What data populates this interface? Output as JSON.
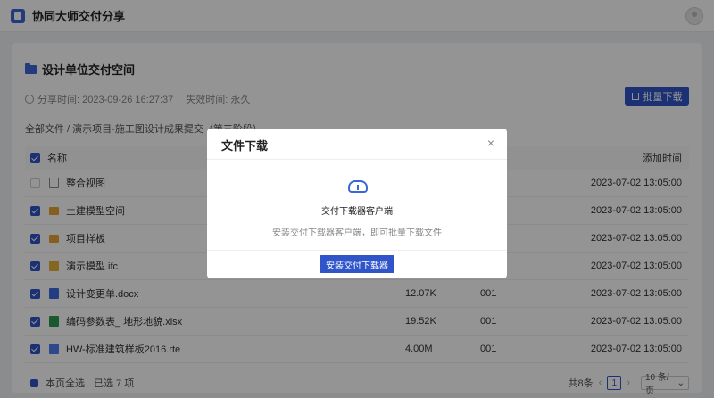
{
  "app": {
    "title": "协同大师交付分享"
  },
  "space": {
    "title": "设计单位交付空间",
    "share_time": "分享时间: 2023-09-26 16:27:37",
    "expire_time": "失效时间: 永久",
    "batch_download": "批量下载",
    "breadcrumb": "全部文件 / 演示项目-施工图设计成果提交（第三阶段）"
  },
  "table": {
    "headers": {
      "name": "名称",
      "time": "添加时间"
    },
    "rows": [
      {
        "name": "整合视图",
        "size": "",
        "version": "",
        "time": "2023-07-02 13:05:00",
        "icon": "model-icon",
        "checked": false
      },
      {
        "name": "土建模型空间",
        "size": "",
        "version": "",
        "time": "2023-07-02 13:05:00",
        "icon": "folder-icon",
        "checked": true
      },
      {
        "name": "项目样板",
        "size": "",
        "version": "",
        "time": "2023-07-02 13:05:00",
        "icon": "folder-icon",
        "checked": true
      },
      {
        "name": "演示模型.ifc",
        "size": "",
        "version": "",
        "time": "2023-07-02 13:05:00",
        "icon": "ifc-file-icon",
        "checked": true
      },
      {
        "name": "设计变更单.docx",
        "size": "12.07K",
        "version": "001",
        "time": "2023-07-02 13:05:00",
        "icon": "docx-file-icon",
        "checked": true
      },
      {
        "name": "编码参数表_ 地形地貌.xlsx",
        "size": "19.52K",
        "version": "001",
        "time": "2023-07-02 13:05:00",
        "icon": "xlsx-file-icon",
        "checked": true
      },
      {
        "name": "HW-标准建筑样板2016.rte",
        "size": "4.00M",
        "version": "001",
        "time": "2023-07-02 13:05:00",
        "icon": "rte-file-icon",
        "checked": true
      }
    ]
  },
  "footer": {
    "select_page": "本页全选",
    "selected": "已选 7 项",
    "total": "共8条",
    "page": "1",
    "page_size": "10 条/页"
  },
  "modal": {
    "title": "文件下载",
    "close": "×",
    "heading": "交付下载器客户端",
    "desc": "安装交付下载器客户端，即可批量下载文件",
    "install": "安装交付下载器"
  }
}
